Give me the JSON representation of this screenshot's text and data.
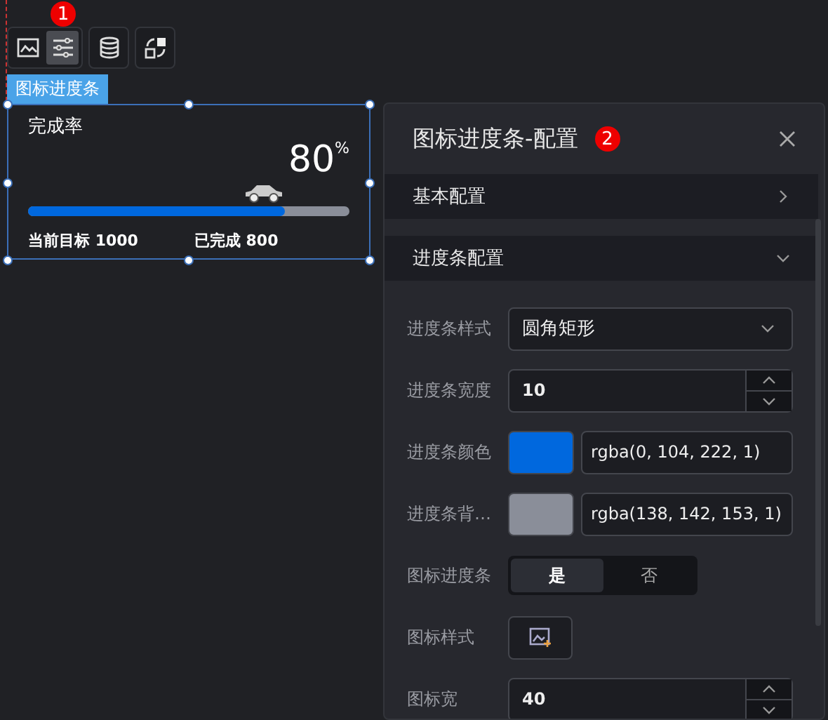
{
  "toolbar": {
    "badge": "1",
    "buttons": [
      {
        "kind": "image",
        "selected": false
      },
      {
        "kind": "sliders",
        "selected": true
      },
      {
        "kind": "database",
        "selected": false
      },
      {
        "kind": "swap",
        "selected": false
      }
    ]
  },
  "widget": {
    "tag": "图标进度条",
    "title": "完成率",
    "value": "80",
    "unit": "%",
    "level": 0.8,
    "target": "当前目标 1000",
    "done": "已完成 800"
  },
  "panel": {
    "title": "图标进度条-配置",
    "badge": "2",
    "sections": [
      {
        "title": "基本配置",
        "expanded": false
      },
      {
        "title": "进度条配置",
        "expanded": true
      }
    ],
    "fields": [
      {
        "kind": "select",
        "label": "进度条样式",
        "value": "圆角矩形"
      },
      {
        "kind": "number",
        "label": "进度条宽度",
        "value": "10"
      },
      {
        "kind": "color",
        "label": "进度条颜色",
        "color": "#0068de",
        "value": "rgba(0, 104, 222, 1)"
      },
      {
        "kind": "color",
        "label": "进度条背…",
        "color": "#8a8e99",
        "value": "rgba(138, 142, 153, 1)"
      },
      {
        "kind": "toggle",
        "label": "图标进度条",
        "options": [
          {
            "label": "是",
            "selected": true
          },
          {
            "label": "否",
            "selected": false
          }
        ]
      },
      {
        "kind": "icon",
        "label": "图标样式"
      },
      {
        "kind": "number",
        "label": "图标宽",
        "value": "40"
      }
    ]
  }
}
